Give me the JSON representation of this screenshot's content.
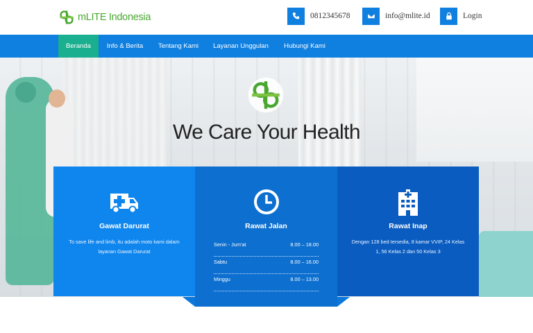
{
  "header": {
    "brand": "mLITE Indonesia",
    "phone": "0812345678",
    "email": "info@mlite.id",
    "login": "Login",
    "icons": {
      "phone": "phone-icon",
      "email": "envelope-icon",
      "login": "lock-icon"
    }
  },
  "nav": {
    "items": [
      {
        "label": "Beranda",
        "active": true
      },
      {
        "label": "Info & Berita",
        "active": false
      },
      {
        "label": "Tentang Kami",
        "active": false
      },
      {
        "label": "Layanan Unggulan",
        "active": false
      },
      {
        "label": "Hubungi Kami",
        "active": false
      }
    ]
  },
  "hero": {
    "title": "We Care Your Health"
  },
  "services": [
    {
      "title": "Gawat Darurat",
      "icon": "ambulance-icon",
      "description": "To save life and limb, itu adalah moto kami dalam layanan Gawat Darurat"
    },
    {
      "title": "Rawat Jalan",
      "icon": "clock-icon",
      "hours": [
        {
          "day": "Senin - Jum'at",
          "time": "8.00 – 18.00"
        },
        {
          "day": "Sabtu",
          "time": "8.00 – 16.00"
        },
        {
          "day": "Minggu",
          "time": "8.00 – 13.00"
        }
      ]
    },
    {
      "title": "Rawat Inap",
      "icon": "hospital-icon",
      "description": "Dengan 128 bed tersedia, 8 kamar VVIP, 24 Kelas 1, 56 Kelas 2 dan 50 Kelas 3"
    }
  ],
  "colors": {
    "primary": "#0f7fe0",
    "active_nav": "#1aaf8f",
    "brand_green": "#49a730",
    "panel_1": "#0f86ee",
    "panel_2": "#0d6fcf",
    "panel_3": "#0a5cc0"
  }
}
